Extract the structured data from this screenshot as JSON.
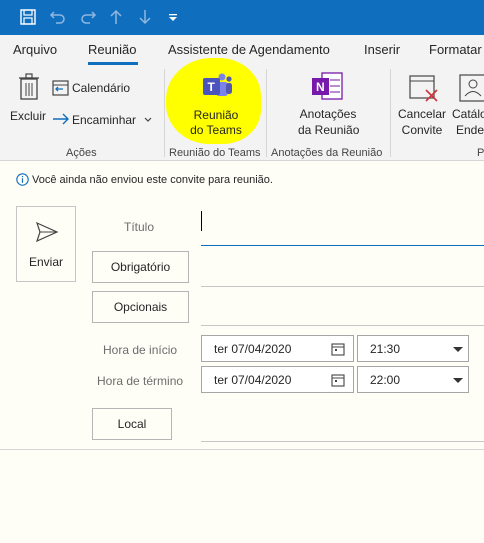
{
  "tabs": [
    "Arquivo",
    "Reunião",
    "Assistente de Agendamento",
    "Inserir",
    "Formatar"
  ],
  "ribbon": {
    "delete": "Excluir",
    "calendar": "Calendário",
    "forward": "Encaminhar",
    "teams_line1": "Reunião",
    "teams_line2": "do Teams",
    "notes_line1": "Anotações",
    "notes_line2": "da Reunião",
    "cancel_line1": "Cancelar",
    "cancel_line2": "Convite",
    "catalog_line1": "Catálo",
    "catalog_line2": "Ender",
    "groups": [
      "Ações",
      "Reunião do Teams",
      "Anotações da Reunião",
      "P"
    ]
  },
  "info": "Você ainda não enviou este convite para reunião.",
  "form": {
    "send": "Enviar",
    "title_label": "Título",
    "required_button": "Obrigatório",
    "optional_button": "Opcionais",
    "start_label": "Hora de início",
    "end_label": "Hora de término",
    "start_date": "ter 07/04/2020",
    "start_time": "21:30",
    "end_date": "ter 07/04/2020",
    "end_time": "22:00",
    "location_button": "Local"
  },
  "colors": {
    "accent": "#106ebe",
    "highlight": "#ffff00",
    "teams": "#5558af",
    "onenote": "#7719aa"
  }
}
